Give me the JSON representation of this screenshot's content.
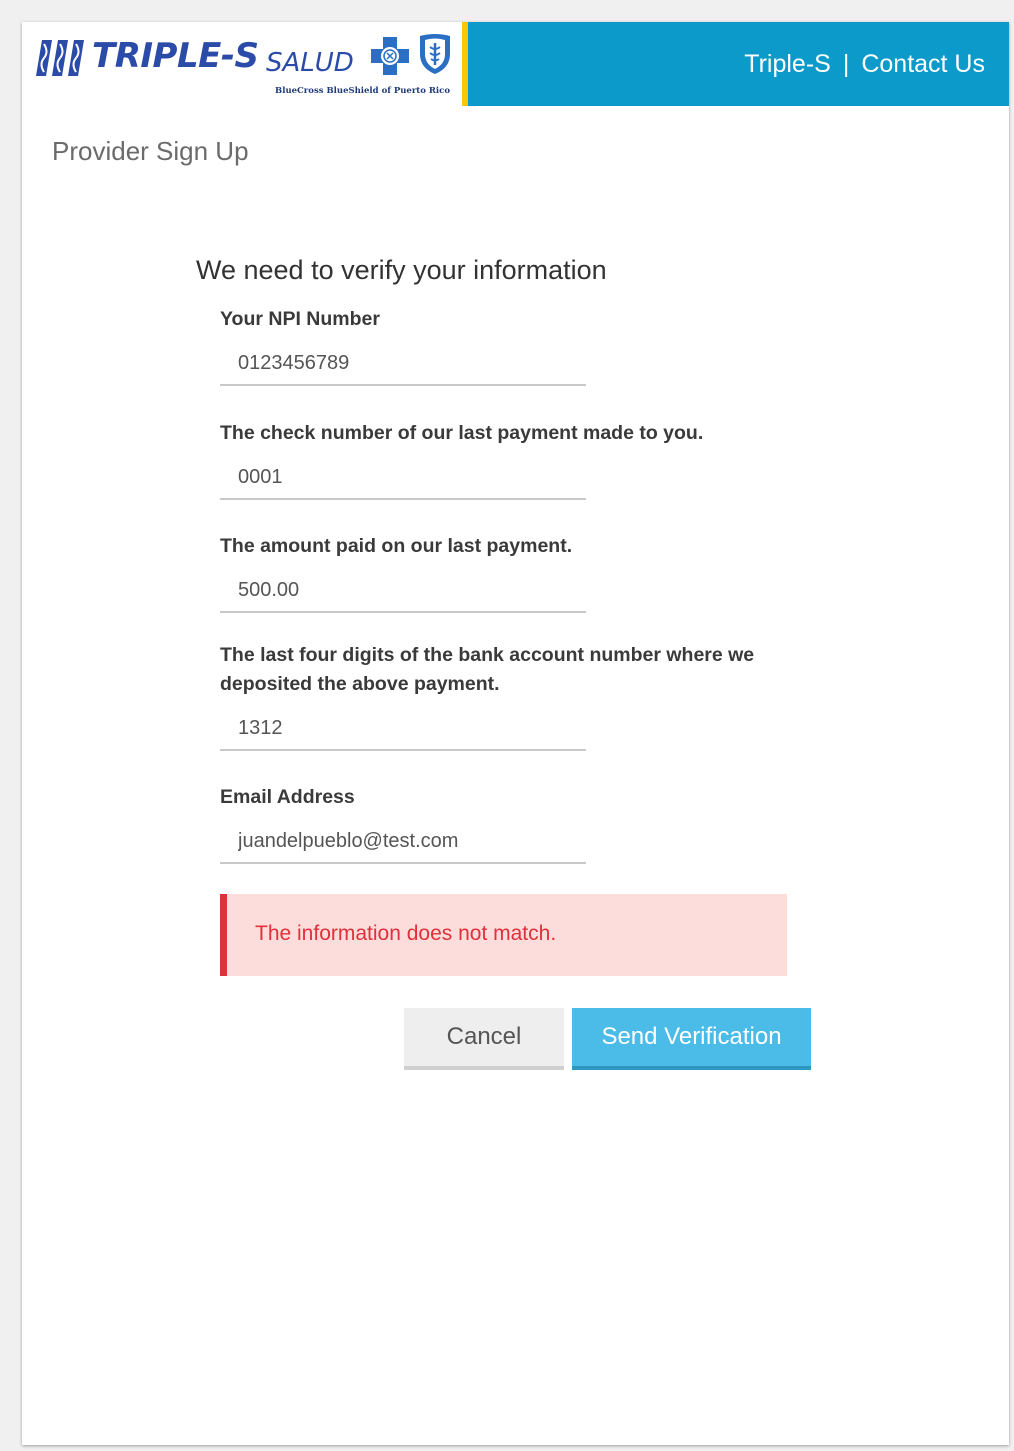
{
  "header": {
    "logo": {
      "wordmark": "TRIPLE-S",
      "wordmark_sub": "SALUD",
      "tagline": "BlueCross BlueShield of Puerto Rico"
    },
    "links": [
      {
        "label": "Triple-S"
      },
      {
        "label": "Contact Us"
      }
    ],
    "separator": "|"
  },
  "page": {
    "title": "Provider Sign Up"
  },
  "form": {
    "heading": "We need to verify your information",
    "fields": [
      {
        "label": "Your NPI Number",
        "value": "0123456789"
      },
      {
        "label": "The check number of our last payment made to you.",
        "value": "0001"
      },
      {
        "label": "The amount paid on our last payment.",
        "value": "500.00"
      },
      {
        "label": "The last four digits of the bank account number where we deposited the above payment.",
        "value": "1312"
      },
      {
        "label": "Email Address",
        "value": "juandelpueblo@test.com"
      }
    ],
    "error_message": "The information does not match.",
    "cancel_label": "Cancel",
    "submit_label": "Send Verification"
  },
  "colors": {
    "header_blue": "#0b9ac9",
    "header_gold": "#f5c800",
    "brand_blue": "#2b4ba8",
    "error_red": "#e0303a",
    "error_bg": "#fddcdc",
    "primary_button": "#4bbbe8"
  },
  "icons": {
    "logo_bars": "triple-s-bars-icon",
    "logo_cross": "bluecross-icon",
    "logo_shield": "blueshield-icon"
  }
}
